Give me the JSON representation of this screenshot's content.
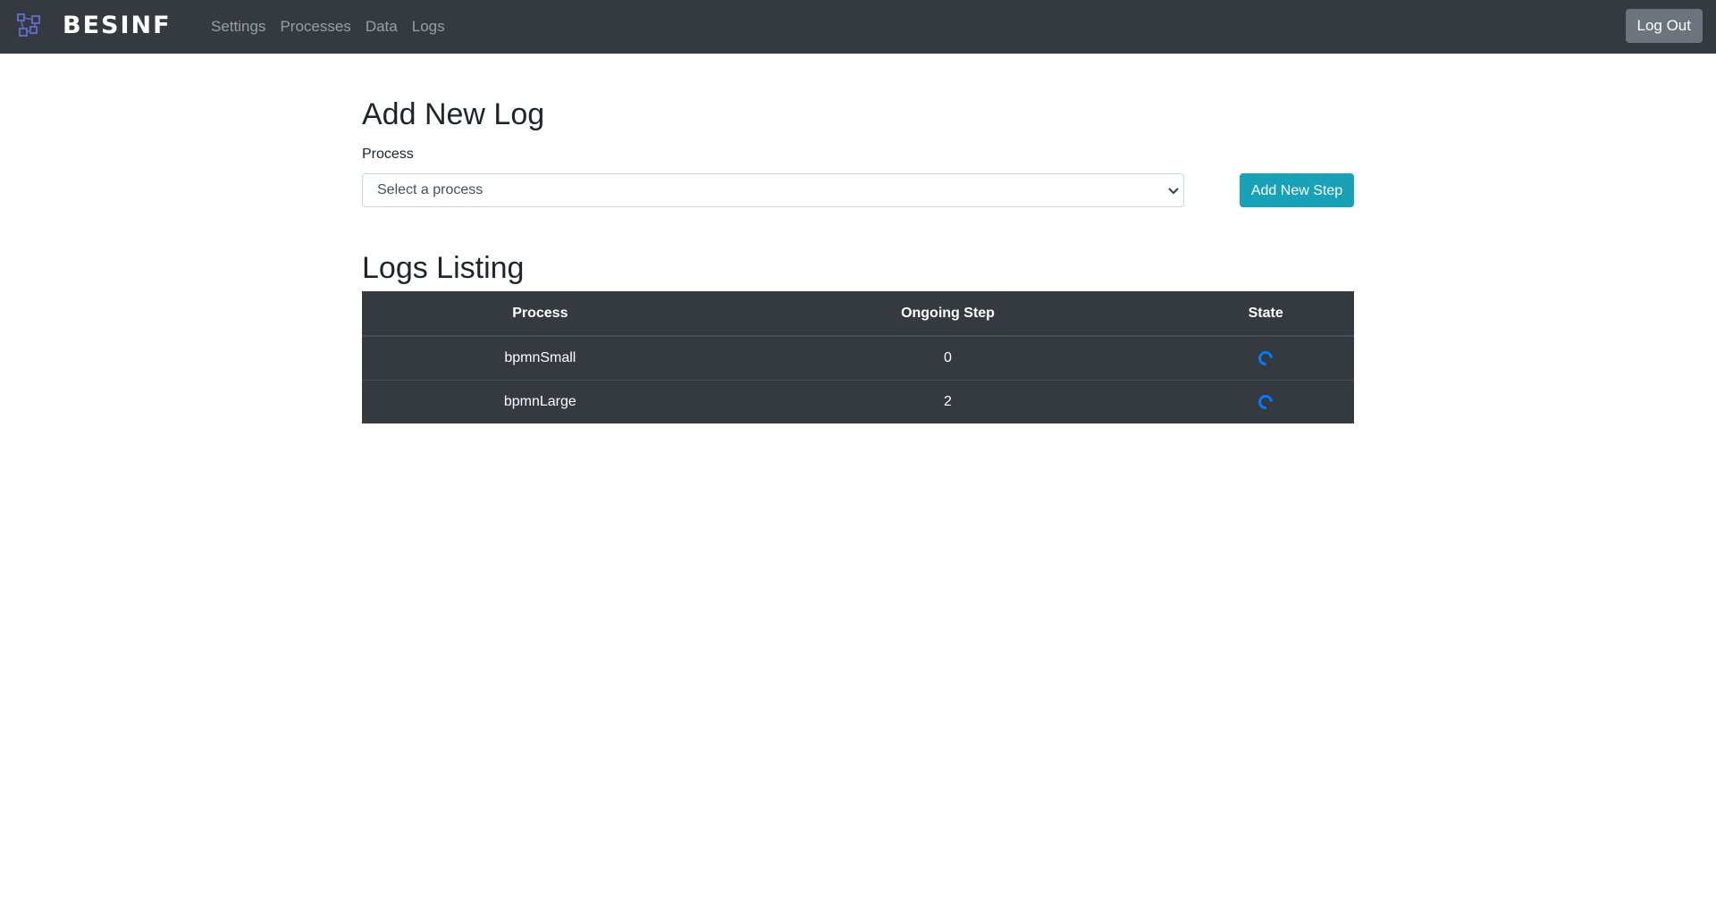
{
  "app": {
    "brand_name": "BESINF",
    "logo_icon": "network-diagram-icon"
  },
  "nav": {
    "items": [
      {
        "label": "Settings"
      },
      {
        "label": "Processes"
      },
      {
        "label": "Data"
      },
      {
        "label": "Logs"
      }
    ],
    "logout_label": "Log Out"
  },
  "add_log": {
    "title": "Add New Log",
    "process_label": "Process",
    "select_value": "Select a process",
    "add_step_label": "Add New Step"
  },
  "logs": {
    "title": "Logs Listing",
    "columns": [
      "Process",
      "Ongoing Step",
      "State"
    ],
    "rows": [
      {
        "process": "bpmnSmall",
        "step": "0",
        "state_icon": "loading-spinner-icon"
      },
      {
        "process": "bpmnLarge",
        "step": "2",
        "state_icon": "loading-spinner-icon"
      }
    ]
  },
  "colors": {
    "navbar": "#343a40",
    "info_button": "#17a2b8",
    "secondary_button": "#6c757d",
    "spinner": "#007bff"
  }
}
